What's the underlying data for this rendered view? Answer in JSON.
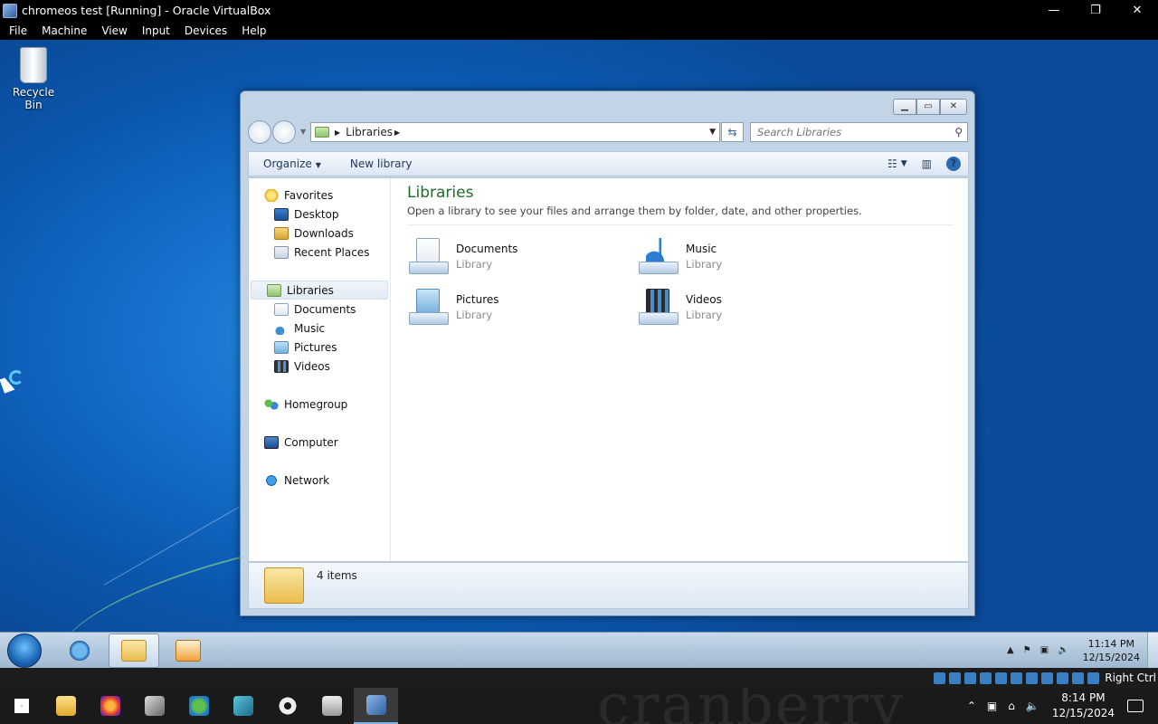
{
  "vbox": {
    "window_title": "chromeos test [Running] - Oracle VirtualBox",
    "controls": {
      "minimize": "—",
      "restore": "❐",
      "close": "✕"
    },
    "menu": [
      "File",
      "Machine",
      "View",
      "Input",
      "Devices",
      "Help"
    ],
    "host_key": "Right Ctrl"
  },
  "desktop": {
    "recycle_bin_label": "Recycle Bin"
  },
  "explorer": {
    "address": {
      "crumb": "Libraries"
    },
    "search_placeholder": "Search Libraries",
    "toolbar": {
      "organize": "Organize",
      "new_library": "New library"
    },
    "nav": {
      "favorites": "Favorites",
      "favorites_items": [
        "Desktop",
        "Downloads",
        "Recent Places"
      ],
      "libraries": "Libraries",
      "libraries_items": [
        "Documents",
        "Music",
        "Pictures",
        "Videos"
      ],
      "homegroup": "Homegroup",
      "computer": "Computer",
      "network": "Network"
    },
    "content": {
      "title": "Libraries",
      "description": "Open a library to see your files and arrange them by folder, date, and other properties.",
      "libraries": [
        {
          "name": "Documents",
          "type": "Library"
        },
        {
          "name": "Music",
          "type": "Library"
        },
        {
          "name": "Pictures",
          "type": "Library"
        },
        {
          "name": "Videos",
          "type": "Library"
        }
      ]
    },
    "status": {
      "item_count": "4 items"
    }
  },
  "guest_taskbar": {
    "clock_time": "11:14 PM",
    "clock_date": "12/15/2024"
  },
  "host_taskbar": {
    "clock_time": "8:14 PM",
    "clock_date": "12/15/2024",
    "wallpaper_text": "cranberry"
  }
}
